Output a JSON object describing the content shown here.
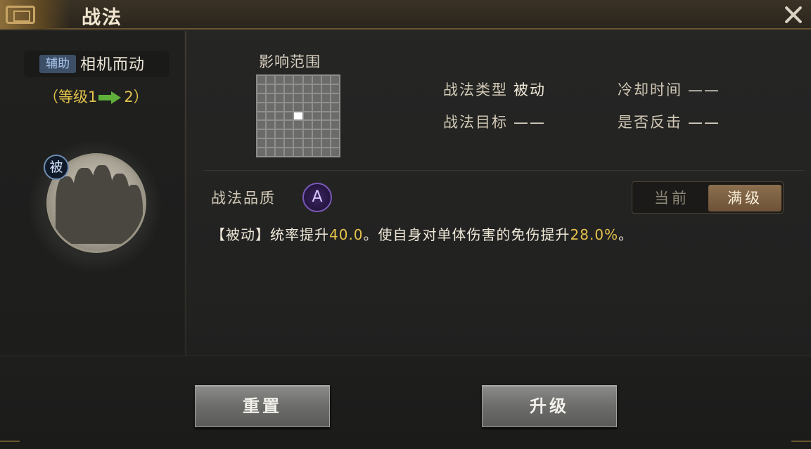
{
  "window": {
    "title": "战法"
  },
  "skill": {
    "type_badge": "辅助",
    "name": "相机而动",
    "level_prefix": "（等级1",
    "level_suffix": "2）",
    "passive_badge": "被"
  },
  "range": {
    "label": "影响范围",
    "rows": 9,
    "cols": 9,
    "active_cell": [
      4,
      4
    ]
  },
  "info": {
    "type_key": "战法类型",
    "type_val": "被动",
    "cooldown_key": "冷却时间",
    "cooldown_val": "——",
    "target_key": "战法目标",
    "target_val": "——",
    "counter_key": "是否反击",
    "counter_val": "——"
  },
  "quality": {
    "label": "战法品质",
    "grade": "A"
  },
  "toggle": {
    "current": "当前",
    "max": "满级",
    "selected": "max"
  },
  "description": {
    "prefix": "【被动】统率提升",
    "value1": "40.0",
    "middle": "。使自身对单体伤害的免伤提升",
    "value2": "28.0%",
    "suffix": "。"
  },
  "buttons": {
    "reset": "重置",
    "upgrade": "升级"
  },
  "colors": {
    "accent_gold": "#e0c14a",
    "level_arrow": "#5fb03a",
    "quality_purple": "#7a58b6"
  }
}
